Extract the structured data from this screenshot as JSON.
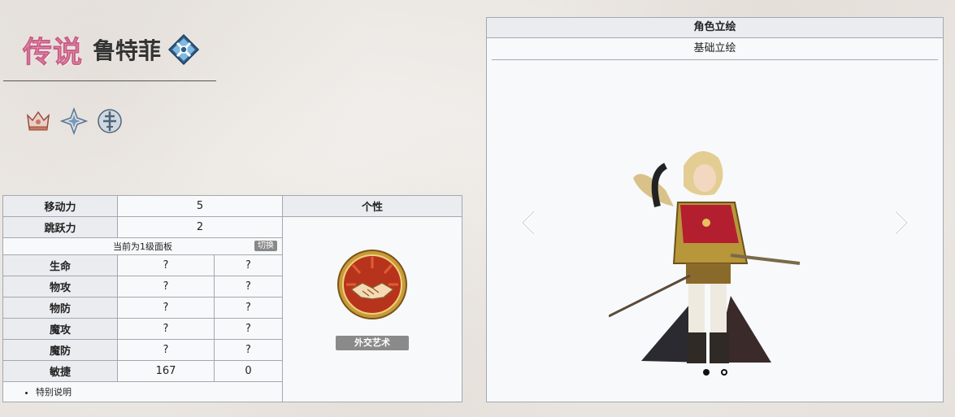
{
  "header": {
    "rarity": "传说",
    "name": "鲁特菲",
    "class_icon": "lance-crest-icon"
  },
  "attributes": {
    "icons": [
      "crown-icon",
      "star-compass-icon",
      "sword-crest-icon"
    ]
  },
  "stats": {
    "move_label": "移动力",
    "move_value": "5",
    "jump_label": "跳跃力",
    "jump_value": "2",
    "trait_header": "个性",
    "panel_text": "当前为1级面板",
    "toggle_label": "切换",
    "rows": [
      {
        "label": "生命",
        "base": "?",
        "bonus": "?"
      },
      {
        "label": "物攻",
        "base": "?",
        "bonus": "?"
      },
      {
        "label": "物防",
        "base": "?",
        "bonus": "?"
      },
      {
        "label": "魔攻",
        "base": "?",
        "bonus": "?"
      },
      {
        "label": "魔防",
        "base": "?",
        "bonus": "?"
      },
      {
        "label": "敏捷",
        "base": "167",
        "bonus": "0"
      }
    ],
    "trait_name": "外交艺术",
    "trait_icon": "handshake-icon",
    "note": "特别说明"
  },
  "art": {
    "header": "角色立绘",
    "tab": "基础立绘",
    "page_index": 1,
    "page_count": 2
  },
  "colors": {
    "rarity_fill": "#f4b3c7",
    "rarity_stroke": "#c85f86",
    "table_header": "#eaecf0",
    "table_border": "#a2a9b1"
  }
}
